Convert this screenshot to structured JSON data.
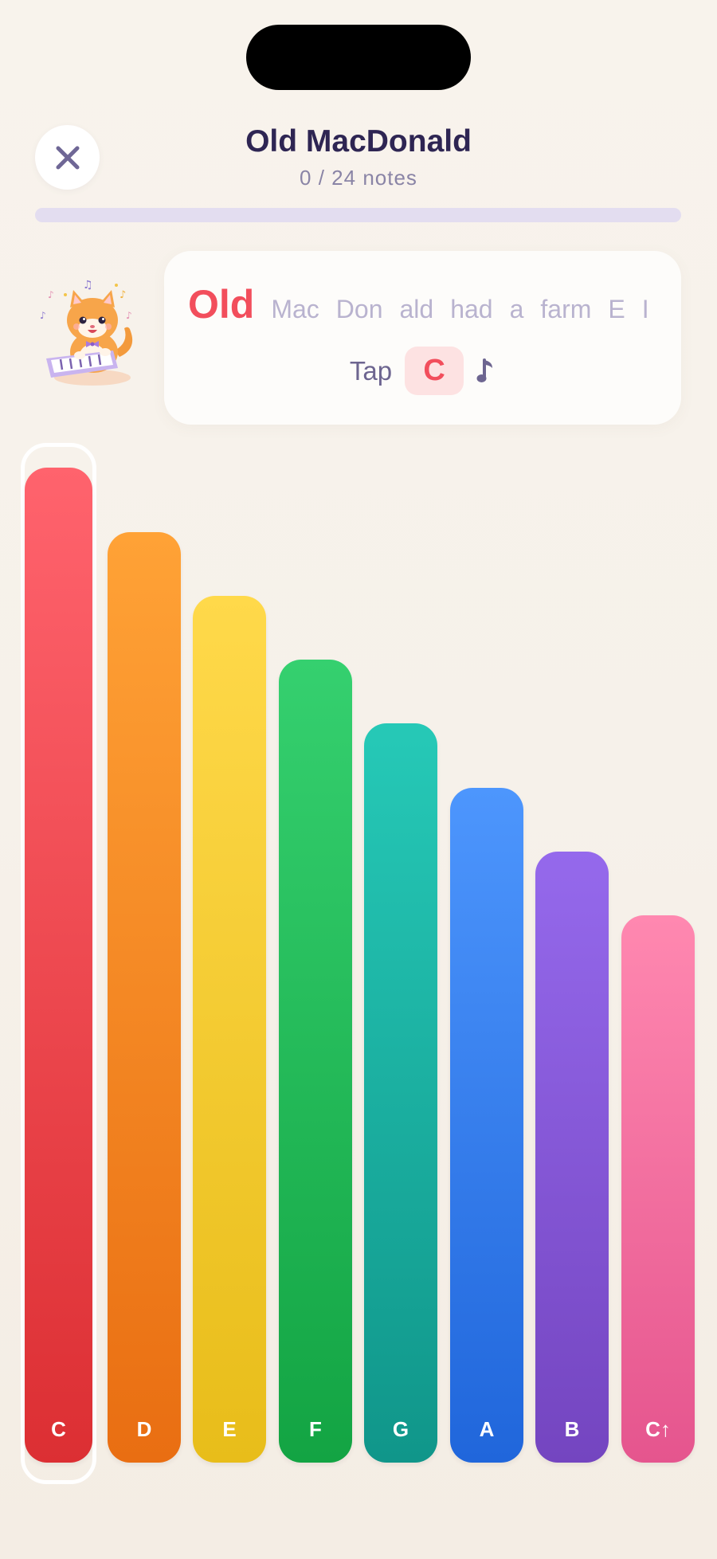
{
  "header": {
    "title": "Old MacDonald",
    "progress_text": "0 / 24 notes",
    "progress_fraction": 0
  },
  "lyrics": {
    "words": [
      "Old",
      "Mac",
      "Don",
      "ald",
      "had",
      "a",
      "farm",
      "E",
      "I"
    ],
    "current_index": 0
  },
  "prompt": {
    "tap_label": "Tap",
    "note": "C"
  },
  "icons": {
    "close": "close-icon",
    "music": "music-note-icon",
    "mascot": "cat-piano-mascot"
  },
  "bars": [
    {
      "label": "C",
      "colors": [
        "#ff636d",
        "#dc2f33"
      ],
      "active": true
    },
    {
      "label": "D",
      "colors": [
        "#ffa236",
        "#e96e12"
      ]
    },
    {
      "label": "E",
      "colors": [
        "#ffd94a",
        "#e8bd1a"
      ]
    },
    {
      "label": "F",
      "colors": [
        "#35d06f",
        "#13a443"
      ]
    },
    {
      "label": "G",
      "colors": [
        "#26c9b7",
        "#10968a"
      ]
    },
    {
      "label": "A",
      "colors": [
        "#4d96fd",
        "#2066db"
      ]
    },
    {
      "label": "B",
      "colors": [
        "#9569ec",
        "#7445c0"
      ]
    },
    {
      "label": "C↑",
      "colors": [
        "#ff88b0",
        "#e5558e"
      ]
    }
  ]
}
